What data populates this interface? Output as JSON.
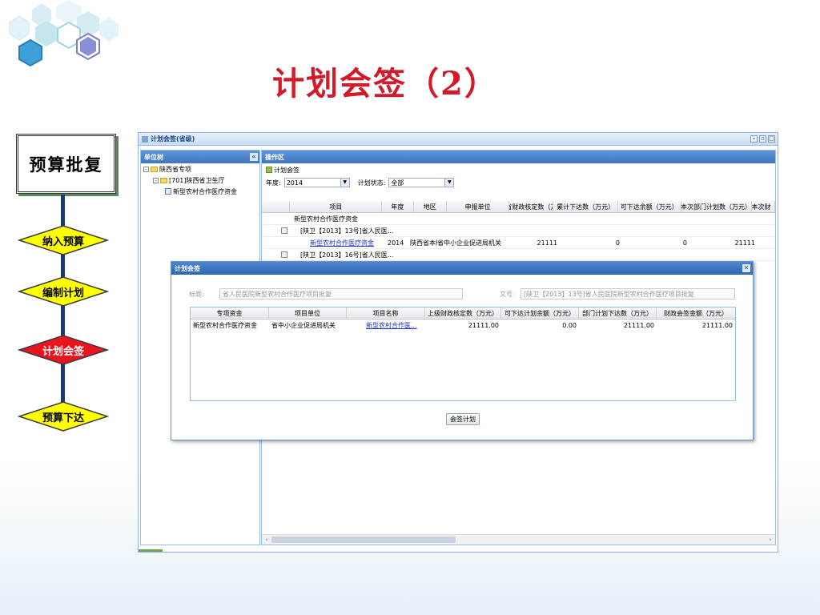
{
  "slide": {
    "title": "计划会签（2）"
  },
  "flow": {
    "title": "预算批复",
    "steps": [
      "纳入预算",
      "编制计划",
      "计划会签",
      "预算下达"
    ],
    "active_step": "计划会签",
    "colors": {
      "normal": "#ffff00",
      "active": "#e8141e",
      "line": "#1c3a6a"
    }
  },
  "app": {
    "window_title": "计划会签(省级)",
    "tree_panel": {
      "title": "单位树",
      "nodes": [
        "陕西省专项",
        "[701]陕西省卫生厅",
        "新型农村合作医疗资金"
      ]
    },
    "work_panel": {
      "title": "操作区",
      "breadcrumb": "计划会签",
      "year_label": "年度:",
      "year_value": "2014",
      "status_label": "计划状态:",
      "status_value": "全部",
      "columns": [
        "项目",
        "年度",
        "地区",
        "申报单位",
        "省财政核定数（万",
        "累计下达数（万元）",
        "可下达余额（万元）",
        "本次部门计划数（万元）",
        "本次财"
      ],
      "rows": [
        {
          "project": "新型农村合作医疗资金",
          "year": "",
          "region": "",
          "unit": "",
          "approved": "",
          "issued": "",
          "balance": "",
          "plan": ""
        },
        {
          "project": "[陕卫【2013】13号]省人民医...",
          "year": "",
          "region": "",
          "unit": "",
          "approved": "",
          "issued": "",
          "balance": "",
          "plan": ""
        },
        {
          "project": "新型农村合作医疗资金",
          "year": "2014",
          "region": "陕西省本级",
          "unit": "省中小企业促进局机关",
          "approved": "21111",
          "issued": "0",
          "balance": "0",
          "plan": "21111"
        },
        {
          "project": "[陕卫【2013】16号]省人民医...",
          "year": "",
          "region": "",
          "unit": "",
          "approved": "",
          "issued": "",
          "balance": "",
          "plan": ""
        }
      ]
    }
  },
  "dialog": {
    "title": "计划会签",
    "title_label": "标题:",
    "title_value": "省人民医院新型农村合作医疗项目批复",
    "doc_label": "文号:",
    "doc_value": "[陕卫【2013】13号]省人民医院新型农村合作医疗项目批复",
    "columns": [
      "专项资金",
      "项目单位",
      "项目名称",
      "上级财政核定数（万元）",
      "可下达计划余额（万元）",
      "部门计划下达数（万元）",
      "财政会签金额（万元）"
    ],
    "rows": [
      {
        "fund": "新型农村合作医疗资金",
        "unit": "省中小企业促进局机关",
        "name": "新型农村合作医...",
        "approved": "21111.00",
        "balance": "0.00",
        "dept_plan": "21111.00",
        "sign_amount": "21111.00"
      }
    ],
    "button": "会签计划"
  }
}
